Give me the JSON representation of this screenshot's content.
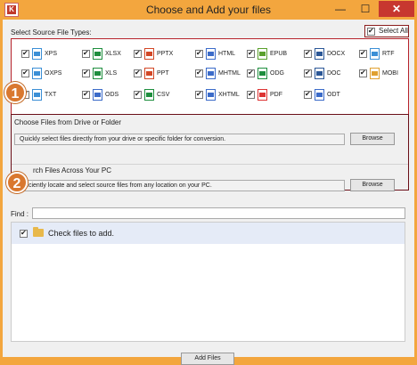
{
  "window": {
    "title": "Choose and Add your files",
    "app_icon_letter": "K",
    "controls": {
      "minimize": "—",
      "maximize": "☐",
      "close": "✕"
    }
  },
  "source_types": {
    "label": "Select Source File Types:",
    "select_all_label": "Select All",
    "select_all_checked": true,
    "items": [
      {
        "label": "XPS",
        "checked": true,
        "icon": "xps-file-icon",
        "color": "#3b8fd6"
      },
      {
        "label": "XLSX",
        "checked": true,
        "icon": "xlsx-file-icon",
        "color": "#1e8e3e"
      },
      {
        "label": "PPTX",
        "checked": true,
        "icon": "pptx-file-icon",
        "color": "#d24726"
      },
      {
        "label": "HTML",
        "checked": true,
        "icon": "html-file-icon",
        "color": "#3b6bc9"
      },
      {
        "label": "EPUB",
        "checked": true,
        "icon": "epub-file-icon",
        "color": "#5aa02c"
      },
      {
        "label": "DOCX",
        "checked": true,
        "icon": "docx-file-icon",
        "color": "#2b5797"
      },
      {
        "label": "RTF",
        "checked": true,
        "icon": "rtf-file-icon",
        "color": "#3b8fd6"
      },
      {
        "label": "OXPS",
        "checked": true,
        "icon": "oxps-file-icon",
        "color": "#3b8fd6"
      },
      {
        "label": "XLS",
        "checked": true,
        "icon": "xls-file-icon",
        "color": "#1e8e3e"
      },
      {
        "label": "PPT",
        "checked": true,
        "icon": "ppt-file-icon",
        "color": "#d24726"
      },
      {
        "label": "MHTML",
        "checked": true,
        "icon": "mhtml-file-icon",
        "color": "#3b6bc9"
      },
      {
        "label": "ODG",
        "checked": true,
        "icon": "odg-file-icon",
        "color": "#1e8e3e"
      },
      {
        "label": "DOC",
        "checked": true,
        "icon": "doc-file-icon",
        "color": "#2b5797"
      },
      {
        "label": "MOBI",
        "checked": true,
        "icon": "mobi-file-icon",
        "color": "#e0a030"
      },
      {
        "label": "TXT",
        "checked": true,
        "icon": "txt-file-icon",
        "color": "#3b8fd6"
      },
      {
        "label": "ODS",
        "checked": true,
        "icon": "ods-file-icon",
        "color": "#3b6bc9"
      },
      {
        "label": "CSV",
        "checked": true,
        "icon": "csv-file-icon",
        "color": "#1e8e3e"
      },
      {
        "label": "XHTML",
        "checked": true,
        "icon": "xhtml-file-icon",
        "color": "#3b6bc9"
      },
      {
        "label": "PDF",
        "checked": true,
        "icon": "pdf-file-icon",
        "color": "#d33"
      },
      {
        "label": "ODT",
        "checked": true,
        "icon": "odt-file-icon",
        "color": "#3b6bc9"
      }
    ]
  },
  "badges": {
    "one": "1",
    "two": "2"
  },
  "choose_section": {
    "label": "Choose Files from Drive or Folder",
    "field_text": "Quickly select files directly from your drive or specific folder for conversion.",
    "browse_label": "Browse"
  },
  "search_section": {
    "label": "rch Files Across Your PC",
    "field_text": "Efficiently locate and select source files from any location on your PC.",
    "browse_label": "Browse"
  },
  "find": {
    "label": "Find :",
    "value": ""
  },
  "file_list": {
    "header_label": "Check files to add.",
    "checked": false
  },
  "add_button_label": "Add Files"
}
